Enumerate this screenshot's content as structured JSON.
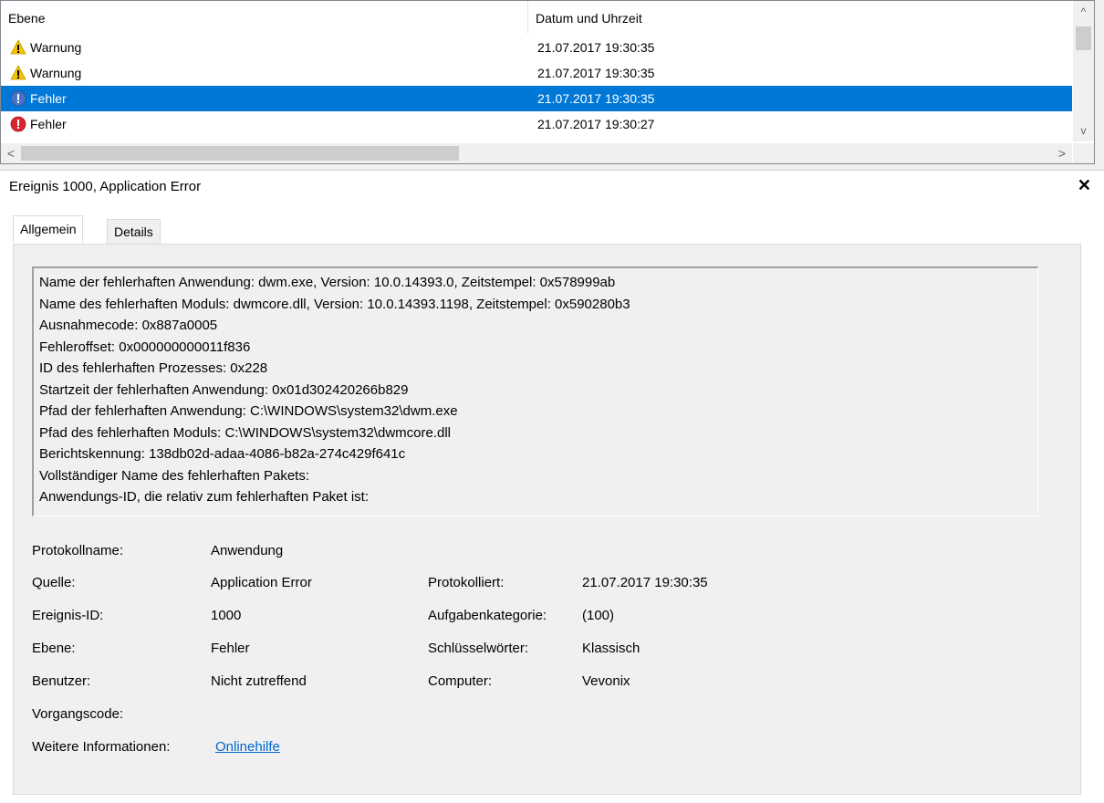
{
  "list": {
    "columns": [
      "Ebene",
      "Datum und Uhrzeit"
    ],
    "rows": [
      {
        "level": "Warnung",
        "icon": "warning-icon",
        "date": "21.07.2017 19:30:35"
      },
      {
        "level": "Warnung",
        "icon": "warning-icon",
        "date": "21.07.2017 19:30:35"
      },
      {
        "level": "Fehler",
        "icon": "error-icon",
        "date": "21.07.2017 19:30:35",
        "selected": true
      },
      {
        "level": "Fehler",
        "icon": "error-icon",
        "date": "21.07.2017 19:30:27"
      }
    ],
    "scroll_up": "^",
    "scroll_down": "v",
    "scroll_left": "<",
    "scroll_right": ">"
  },
  "detail": {
    "title": "Ereignis 1000, Application Error",
    "close": "✕",
    "tabs": [
      "Allgemein",
      "Details"
    ],
    "description": [
      "Name der fehlerhaften Anwendung: dwm.exe, Version: 10.0.14393.0, Zeitstempel: 0x578999ab",
      "Name des fehlerhaften Moduls: dwmcore.dll, Version: 10.0.14393.1198, Zeitstempel: 0x590280b3",
      "Ausnahmecode: 0x887a0005",
      "Fehleroffset: 0x000000000011f836",
      "ID des fehlerhaften Prozesses: 0x228",
      "Startzeit der fehlerhaften Anwendung: 0x01d302420266b829",
      "Pfad der fehlerhaften Anwendung: C:\\WINDOWS\\system32\\dwm.exe",
      "Pfad des fehlerhaften Moduls: C:\\WINDOWS\\system32\\dwmcore.dll",
      "Berichtskennung: 138db02d-adaa-4086-b82a-274c429f641c",
      "Vollständiger Name des fehlerhaften Pakets:",
      "Anwendungs-ID, die relativ zum fehlerhaften Paket ist:"
    ],
    "props": {
      "protokollname_label": "Protokollname:",
      "protokollname": "Anwendung",
      "quelle_label": "Quelle:",
      "quelle": "Application Error",
      "protokolliert_label": "Protokolliert:",
      "protokolliert": "21.07.2017 19:30:35",
      "ereignis_id_label": "Ereignis-ID:",
      "ereignis_id": "1000",
      "aufgabenkategorie_label": "Aufgabenkategorie:",
      "aufgabenkategorie": "(100)",
      "ebene_label": "Ebene:",
      "ebene": "Fehler",
      "schluesselwoerter_label": "Schlüsselwörter:",
      "schluesselwoerter": "Klassisch",
      "benutzer_label": "Benutzer:",
      "benutzer": "Nicht zutreffend",
      "computer_label": "Computer:",
      "computer": "Vevonix",
      "vorgangscode_label": "Vorgangscode:",
      "weitere_label": "Weitere Informationen:",
      "weitere_link": "Onlinehilfe"
    }
  },
  "colors": {
    "selection": "#0078d7",
    "warning": "#f5c400",
    "error": "#d9262c",
    "info_selected": "#4a72c4",
    "link": "#0066cc"
  }
}
